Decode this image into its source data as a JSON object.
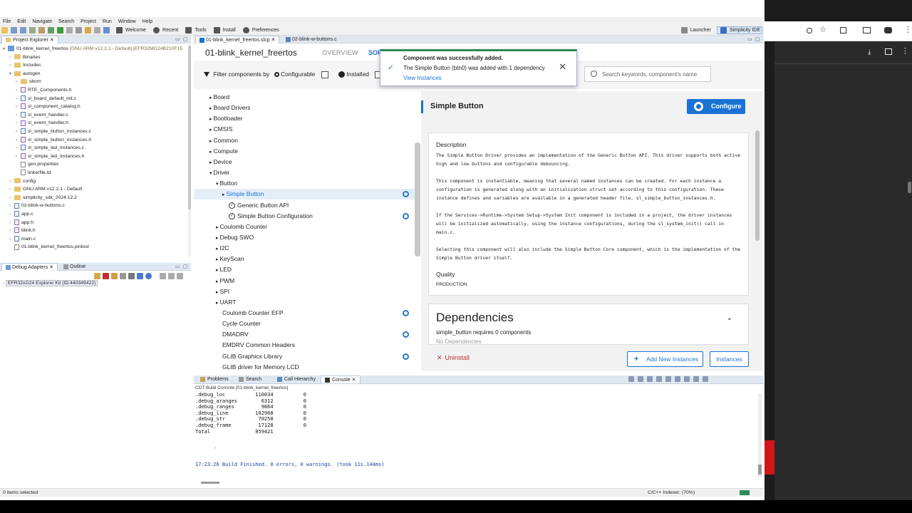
{
  "menu": [
    "File",
    "Edit",
    "Navigate",
    "Search",
    "Project",
    "Run",
    "Window",
    "Help"
  ],
  "toolbar": {
    "welcome": "Welcome",
    "recent": "Recent",
    "tools": "Tools",
    "install": "Install",
    "preferences": "Preferences",
    "launcher": "Launcher",
    "ide": "Simplicity IDE"
  },
  "project_explorer": {
    "tab": "Project Explorer",
    "items": [
      {
        "label": "01-blink_kernel_freertos",
        "detail": " [GNU ARM v12.2.1 - Default] [EFR32MG24B210F15",
        "kind": "project",
        "indent": 0,
        "twisty": "▾"
      },
      {
        "label": "Binaries",
        "kind": "folder",
        "indent": 1,
        "twisty": "›"
      },
      {
        "label": "Includes",
        "kind": "folder",
        "indent": 1,
        "twisty": "›"
      },
      {
        "label": "autogen",
        "kind": "folder",
        "indent": 1,
        "twisty": "▾"
      },
      {
        "label": "sbom",
        "kind": "folder",
        "indent": 2,
        "twisty": "›"
      },
      {
        "label": "RTE_Components.h",
        "kind": "h",
        "indent": 2,
        "twisty": "›"
      },
      {
        "label": "sl_board_default_init.c",
        "kind": "c",
        "indent": 2,
        "twisty": "›"
      },
      {
        "label": "sl_component_catalog.h",
        "kind": "h",
        "indent": 2,
        "twisty": "›"
      },
      {
        "label": "sl_event_handler.c",
        "kind": "c",
        "indent": 2,
        "twisty": "›"
      },
      {
        "label": "sl_event_handler.h",
        "kind": "h",
        "indent": 2,
        "twisty": "›"
      },
      {
        "label": "sl_simple_button_instances.c",
        "kind": "c",
        "indent": 2,
        "twisty": "›"
      },
      {
        "label": "sl_simple_button_instances.h",
        "kind": "h",
        "indent": 2,
        "twisty": "›"
      },
      {
        "label": "sl_simple_led_instances.c",
        "kind": "c",
        "indent": 2,
        "twisty": "›"
      },
      {
        "label": "sl_simple_led_instances.h",
        "kind": "h",
        "indent": 2,
        "twisty": "›"
      },
      {
        "label": "gen.properties",
        "kind": "file",
        "indent": 2,
        "twisty": ""
      },
      {
        "label": "linkerfile.ld",
        "kind": "file",
        "indent": 2,
        "twisty": ""
      },
      {
        "label": "config",
        "kind": "folder",
        "indent": 1,
        "twisty": "›"
      },
      {
        "label": "GNU ARM v12.2.1 - Default",
        "kind": "folder",
        "indent": 1,
        "twisty": "›"
      },
      {
        "label": "simplicity_sdk_2024.12.2",
        "kind": "folder",
        "indent": 1,
        "twisty": "›"
      },
      {
        "label": "02-blink-w-buttons.c",
        "kind": "c",
        "indent": 1,
        "twisty": "›"
      },
      {
        "label": "app.c",
        "kind": "c",
        "indent": 1,
        "twisty": "›"
      },
      {
        "label": "app.h",
        "kind": "h",
        "indent": 1,
        "twisty": "›"
      },
      {
        "label": "blink.h",
        "kind": "h",
        "indent": 1,
        "twisty": "›"
      },
      {
        "label": "main.c",
        "kind": "c",
        "indent": 1,
        "twisty": "›"
      },
      {
        "label": "01-blink_kernel_freertos.pintool",
        "kind": "file",
        "indent": 1,
        "twisty": ""
      }
    ]
  },
  "debug": {
    "tab": "Debug Adapters",
    "tab2": "Outline",
    "adapter": "EFR32xG24 Explorer Kit (ID:440349422)"
  },
  "editor_tabs": [
    "01-blink_kernel_freertos.slcp",
    "02-blink-w-buttons.c"
  ],
  "header": {
    "project": "01-blink_kernel_freertos",
    "overview": "OVERVIEW",
    "software": "SOF"
  },
  "filter": {
    "label": "Filter components by",
    "configurable": "Configurable",
    "installed": "Installed",
    "search_placeholder": "Search keywords, component's name"
  },
  "toast": {
    "title": "Component was successfully added.",
    "body": "The Simple Button (btn0) was added with 1 dependency",
    "link": "View Instances"
  },
  "component_tree": [
    {
      "label": "Board",
      "indent": 0,
      "twisty": "▸",
      "gear": false,
      "icon": ""
    },
    {
      "label": "Board Drivers",
      "indent": 0,
      "twisty": "▸",
      "gear": false,
      "icon": ""
    },
    {
      "label": "Bootloader",
      "indent": 0,
      "twisty": "▸",
      "gear": false,
      "icon": ""
    },
    {
      "label": "CMSIS",
      "indent": 0,
      "twisty": "▸",
      "gear": false,
      "icon": ""
    },
    {
      "label": "Common",
      "indent": 0,
      "twisty": "▸",
      "gear": false,
      "icon": ""
    },
    {
      "label": "Compute",
      "indent": 0,
      "twisty": "▸",
      "gear": false,
      "icon": ""
    },
    {
      "label": "Device",
      "indent": 0,
      "twisty": "▸",
      "gear": false,
      "icon": ""
    },
    {
      "label": "Driver",
      "indent": 0,
      "twisty": "▾",
      "gear": false,
      "icon": ""
    },
    {
      "label": "Button",
      "indent": 1,
      "twisty": "▾",
      "gear": false,
      "icon": ""
    },
    {
      "label": "Simple Button",
      "indent": 2,
      "twisty": "▸",
      "gear": true,
      "icon": "",
      "selected": true
    },
    {
      "label": "Generic Button API",
      "indent": 3,
      "twisty": "",
      "gear": false,
      "icon": "check"
    },
    {
      "label": "Simple Button Configuration",
      "indent": 3,
      "twisty": "",
      "gear": true,
      "icon": "check"
    },
    {
      "label": "Coulomb Counter",
      "indent": 1,
      "twisty": "▸",
      "gear": false,
      "icon": ""
    },
    {
      "label": "Debug SWO",
      "indent": 1,
      "twisty": "▸",
      "gear": false,
      "icon": ""
    },
    {
      "label": "I2C",
      "indent": 1,
      "twisty": "▸",
      "gear": false,
      "icon": ""
    },
    {
      "label": "KeyScan",
      "indent": 1,
      "twisty": "▸",
      "gear": false,
      "icon": ""
    },
    {
      "label": "LED",
      "indent": 1,
      "twisty": "▸",
      "gear": false,
      "icon": ""
    },
    {
      "label": "PWM",
      "indent": 1,
      "twisty": "▸",
      "gear": false,
      "icon": ""
    },
    {
      "label": "SPI",
      "indent": 1,
      "twisty": "▸",
      "gear": false,
      "icon": ""
    },
    {
      "label": "UART",
      "indent": 1,
      "twisty": "▸",
      "gear": false,
      "icon": ""
    },
    {
      "label": "Coulomb Counter EFP",
      "indent": 2,
      "twisty": "",
      "gear": true,
      "icon": ""
    },
    {
      "label": "Cycle Counter",
      "indent": 2,
      "twisty": "",
      "gear": false,
      "icon": ""
    },
    {
      "label": "DMADRV",
      "indent": 2,
      "twisty": "",
      "gear": true,
      "icon": ""
    },
    {
      "label": "EMDRV Common Headers",
      "indent": 2,
      "twisty": "",
      "gear": false,
      "icon": ""
    },
    {
      "label": "GLIB Graphics Library",
      "indent": 2,
      "twisty": "",
      "gear": true,
      "icon": ""
    },
    {
      "label": "GLIB driver for Memory LCD",
      "indent": 2,
      "twisty": "",
      "gear": false,
      "icon": ""
    }
  ],
  "detail": {
    "title": "Simple Button",
    "configure": "Configure",
    "description_h": "Description",
    "description": "The Simple Button Driver provides an implementation of the Generic Button API. This driver supports both active\nhigh and low buttons and configurable debouncing.\n\nThis component is instantiable, meaning that several named instances can be created. For each instance a\nconfiguration is generated along with an initialization struct set according to this configuration. These\ninstance defines and variables are available in a generated header file, sl_simple_button_instances.h.\n\nIf the Services->Runtime->System Setup->System Init component is included in a project, the driver instances\nwill be initialized automatically, using the instance configurations, during the sl_system_init() call in\nmain.c.\n\nSelecting this component will also include the Simple Button Core component, which is the implementation of the\nSimple Button driver itself.",
    "quality_h": "Quality",
    "quality": "PRODUCTION",
    "dependencies_h": "Dependencies",
    "dependencies_sub": "simple_button requires 0 components",
    "dependencies_sub2": "No Dependencies",
    "uninstall": "Uninstall",
    "add_instances": "Add New Instances",
    "instances": "Instances"
  },
  "console": {
    "tabs": [
      "Problems",
      "Search",
      "Call Hierarchy",
      "Console"
    ],
    "title": "CDT Build Console [01-blink_kernel_freertos]",
    "lines": ".debug_loc          110034          0\n.debug_aranges        6312          0\n.debug_ranges         9864          0\n.debug_line         102968          0\n.debug_str           70258          0\n.debug_frame         17128          0\nTotal               859421",
    "final": "17:23:26 Build Finished. 0 errors, 0 warnings. (took 11s.144ms)"
  },
  "status": {
    "left": "0 items selected",
    "right": "C/C++ Indexer: (70%)"
  },
  "colors": {
    "accent": "#1a73d4",
    "success": "#2e8b57",
    "danger": "#c03030"
  }
}
